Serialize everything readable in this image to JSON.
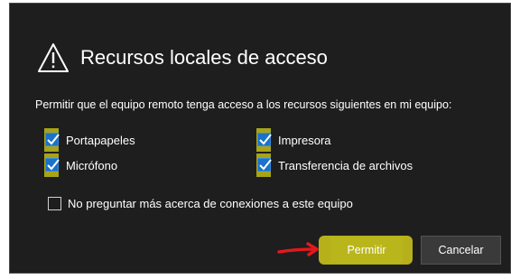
{
  "dialog": {
    "title": "Recursos locales de acceso",
    "icon": "warning-icon",
    "description": "Permitir que el equipo remoto tenga acceso a los recursos siguientes en mi equipo:",
    "resources": [
      {
        "label": "Portapapeles",
        "checked": true
      },
      {
        "label": "Impresora",
        "checked": true
      },
      {
        "label": "Micrófono",
        "checked": true
      },
      {
        "label": "Transferencia de archivos",
        "checked": true
      }
    ],
    "dont_ask": {
      "label": "No preguntar más acerca de conexiones a este equipo",
      "checked": false
    },
    "buttons": {
      "allow": "Permitir",
      "cancel": "Cancelar"
    }
  },
  "colors": {
    "background": "#1e1e1e",
    "highlight": "#b6b11b",
    "checkbox": "#1a73c8",
    "annotation_arrow": "#e0191d"
  }
}
